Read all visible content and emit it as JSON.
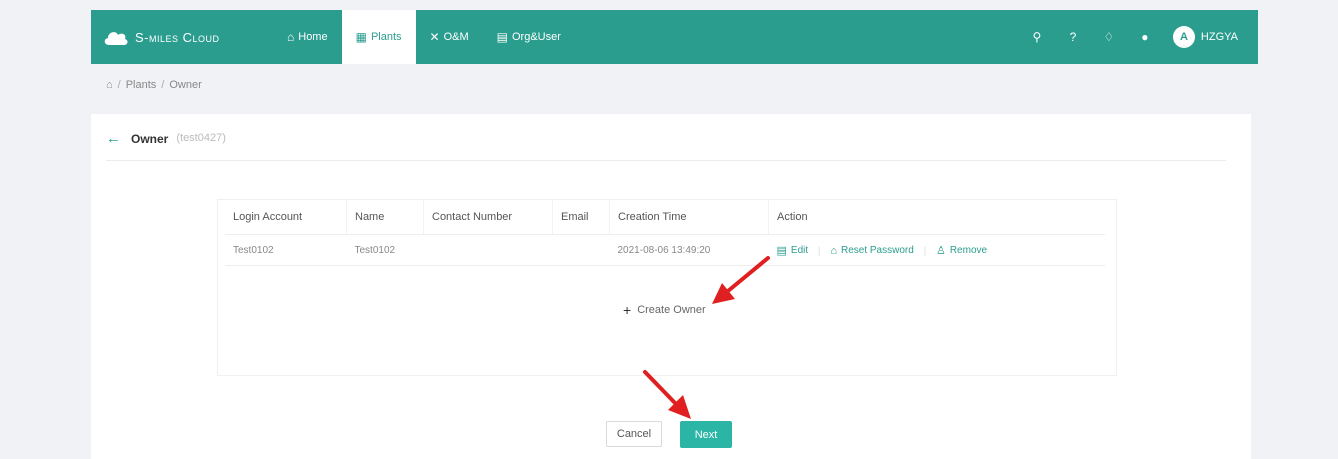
{
  "brand": {
    "name": "S-miles Cloud",
    "icon": "cloud-icon"
  },
  "nav": [
    {
      "label": "Home",
      "icon": "home-icon",
      "active": false
    },
    {
      "label": "Plants",
      "icon": "plants-icon",
      "active": true
    },
    {
      "label": "O&M",
      "icon": "tools-icon",
      "active": false
    },
    {
      "label": "Org&User",
      "icon": "org-icon",
      "active": false
    }
  ],
  "user": {
    "initial": "A",
    "name": "HZGYA"
  },
  "breadcrumb": [
    "Plants",
    "Owner"
  ],
  "page": {
    "title": "Owner",
    "subtitle": "(test0427)"
  },
  "table": {
    "columns": [
      "Login Account",
      "Name",
      "Contact Number",
      "Email",
      "Creation Time",
      "Action"
    ],
    "rows": [
      {
        "login": "Test0102",
        "name": "Test0102",
        "contact": "",
        "email": "",
        "created": "2021-08-06 13:49:20"
      }
    ],
    "actions": {
      "edit": "Edit",
      "reset": "Reset Password",
      "remove": "Remove"
    },
    "create_label": "Create Owner"
  },
  "buttons": {
    "cancel": "Cancel",
    "next": "Next"
  },
  "colors": {
    "brand": "#2a9d8f",
    "primary": "#2ab5a5",
    "annotation": "#e02020"
  }
}
